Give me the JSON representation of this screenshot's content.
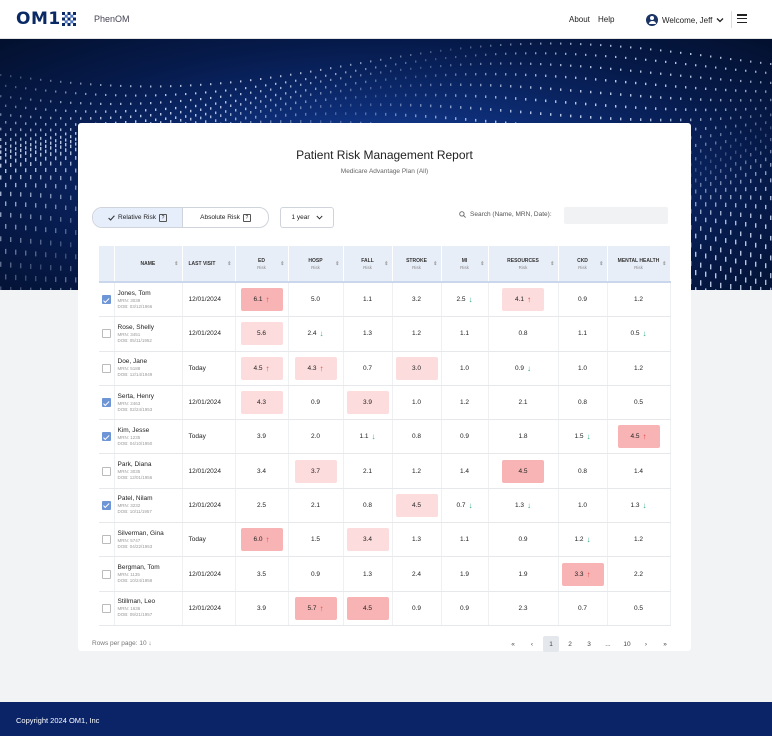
{
  "header": {
    "brand": "OM1",
    "product": "PhenOM",
    "about": "About",
    "help": "Help",
    "welcome": "Welcome, Jeff"
  },
  "report": {
    "title": "Patient Risk Management Report",
    "subtitle": "Medicare Advantage Plan (All)"
  },
  "controls": {
    "relative_label": "Relative Risk",
    "absolute_label": "Absolute Risk",
    "period": "1 year",
    "search_label": "Search (Name, MRN, Date):",
    "search_value": ""
  },
  "columns": [
    {
      "label": "NAME",
      "sub": ""
    },
    {
      "label": "LAST VISIT",
      "sub": ""
    },
    {
      "label": "ED",
      "sub": "Risk"
    },
    {
      "label": "HOSP",
      "sub": "Risk"
    },
    {
      "label": "FALL",
      "sub": "Risk"
    },
    {
      "label": "STROKE",
      "sub": "Risk"
    },
    {
      "label": "MI",
      "sub": "Risk"
    },
    {
      "label": "RESOURCES",
      "sub": "Risk"
    },
    {
      "label": "CKD",
      "sub": "Risk"
    },
    {
      "label": "MENTAL HEALTH",
      "sub": "Risk"
    }
  ],
  "rows": [
    {
      "checked": true,
      "name": "Jones, Tom",
      "mrn": "MRN: 3039",
      "dob": "DOB: 03/12/1966",
      "visit": "12/01/2024",
      "cells": [
        {
          "v": "6.1",
          "t": "up",
          "h": 1
        },
        {
          "v": "5.0"
        },
        {
          "v": "1.1"
        },
        {
          "v": "3.2"
        },
        {
          "v": "2.5",
          "t": "down"
        },
        {
          "v": "4.1",
          "t": "up",
          "h": 2
        },
        {
          "v": "0.9"
        },
        {
          "v": "1.2"
        }
      ]
    },
    {
      "checked": false,
      "name": "Rose, Shelly",
      "mrn": "MRN: 3451",
      "dob": "DOB: 05/11/1952",
      "visit": "12/01/2024",
      "cells": [
        {
          "v": "5.6",
          "h": 2
        },
        {
          "v": "2.4",
          "t": "down"
        },
        {
          "v": "1.3"
        },
        {
          "v": "1.2"
        },
        {
          "v": "1.1"
        },
        {
          "v": "0.8"
        },
        {
          "v": "1.1"
        },
        {
          "v": "0.5",
          "t": "down"
        }
      ]
    },
    {
      "checked": false,
      "name": "Doe, Jane",
      "mrn": "MRN: 5188",
      "dob": "DOB: 12/14/1949",
      "visit": "Today",
      "cells": [
        {
          "v": "4.5",
          "t": "up",
          "h": 2
        },
        {
          "v": "4.3",
          "t": "up",
          "h": 2
        },
        {
          "v": "0.7"
        },
        {
          "v": "3.0",
          "h": 2
        },
        {
          "v": "1.0"
        },
        {
          "v": "0.9",
          "t": "down"
        },
        {
          "v": "1.0"
        },
        {
          "v": "1.2"
        }
      ]
    },
    {
      "checked": true,
      "name": "Serta, Henry",
      "mrn": "MRN: 2463",
      "dob": "DOB: 02/24/1953",
      "visit": "12/01/2024",
      "cells": [
        {
          "v": "4.3",
          "h": 2
        },
        {
          "v": "0.9"
        },
        {
          "v": "3.9",
          "h": 2
        },
        {
          "v": "1.0"
        },
        {
          "v": "1.2"
        },
        {
          "v": "2.1"
        },
        {
          "v": "0.8"
        },
        {
          "v": "0.5"
        }
      ]
    },
    {
      "checked": true,
      "name": "Kim, Jesse",
      "mrn": "MRN: 1235",
      "dob": "DOB: 04/10/1950",
      "visit": "Today",
      "cells": [
        {
          "v": "3.9"
        },
        {
          "v": "2.0"
        },
        {
          "v": "1.1",
          "t": "down"
        },
        {
          "v": "0.8"
        },
        {
          "v": "0.9"
        },
        {
          "v": "1.8"
        },
        {
          "v": "1.5",
          "t": "down"
        },
        {
          "v": "4.5",
          "t": "up",
          "h": 1
        }
      ]
    },
    {
      "checked": false,
      "name": "Park, Diana",
      "mrn": "MRN: 3035",
      "dob": "DOB: 12/01/1956",
      "visit": "12/01/2024",
      "cells": [
        {
          "v": "3.4"
        },
        {
          "v": "3.7",
          "h": 2
        },
        {
          "v": "2.1"
        },
        {
          "v": "1.2"
        },
        {
          "v": "1.4"
        },
        {
          "v": "4.5",
          "h": 1
        },
        {
          "v": "0.8"
        },
        {
          "v": "1.4"
        }
      ]
    },
    {
      "checked": true,
      "name": "Patel, Nilam",
      "mrn": "MRN: 3232",
      "dob": "DOB: 10/11/1957",
      "visit": "12/01/2024",
      "cells": [
        {
          "v": "2.5"
        },
        {
          "v": "2.1"
        },
        {
          "v": "0.8"
        },
        {
          "v": "4.5",
          "h": 2
        },
        {
          "v": "0.7",
          "t": "down"
        },
        {
          "v": "1.3",
          "t": "down"
        },
        {
          "v": "1.0"
        },
        {
          "v": "1.3",
          "t": "down"
        }
      ]
    },
    {
      "checked": false,
      "name": "Silverman, Gina",
      "mrn": "MRN: 5747",
      "dob": "DOB: 04/22/1953",
      "visit": "Today",
      "cells": [
        {
          "v": "6.0",
          "t": "up",
          "h": 1
        },
        {
          "v": "1.5"
        },
        {
          "v": "3.4",
          "h": 2
        },
        {
          "v": "1.3"
        },
        {
          "v": "1.1"
        },
        {
          "v": "0.9"
        },
        {
          "v": "1.2",
          "t": "down"
        },
        {
          "v": "1.2"
        }
      ]
    },
    {
      "checked": false,
      "name": "Bergman, Tom",
      "mrn": "MRN: 1135",
      "dob": "DOB: 10/24/1958",
      "visit": "12/01/2024",
      "cells": [
        {
          "v": "3.5"
        },
        {
          "v": "0.9"
        },
        {
          "v": "1.3"
        },
        {
          "v": "2.4"
        },
        {
          "v": "1.9"
        },
        {
          "v": "1.9"
        },
        {
          "v": "3.3",
          "t": "up",
          "h": 1
        },
        {
          "v": "2.2"
        }
      ]
    },
    {
      "checked": false,
      "name": "Stillman, Leo",
      "mrn": "MRN: 1636",
      "dob": "DOB: 09/21/1957",
      "visit": "12/01/2024",
      "cells": [
        {
          "v": "3.9"
        },
        {
          "v": "5.7",
          "t": "up",
          "h": 1
        },
        {
          "v": "4.5",
          "h": 1
        },
        {
          "v": "0.9"
        },
        {
          "v": "0.9"
        },
        {
          "v": "2.3"
        },
        {
          "v": "0.7"
        },
        {
          "v": "0.5"
        }
      ]
    }
  ],
  "pagination": {
    "rows_per_page": "Rows per page: 10",
    "pages": [
      "«",
      "‹",
      "1",
      "2",
      "3",
      "...",
      "10",
      "›",
      "»"
    ],
    "current": "1"
  },
  "footer": {
    "copyright": "Copyright 2024 OM1, Inc"
  }
}
